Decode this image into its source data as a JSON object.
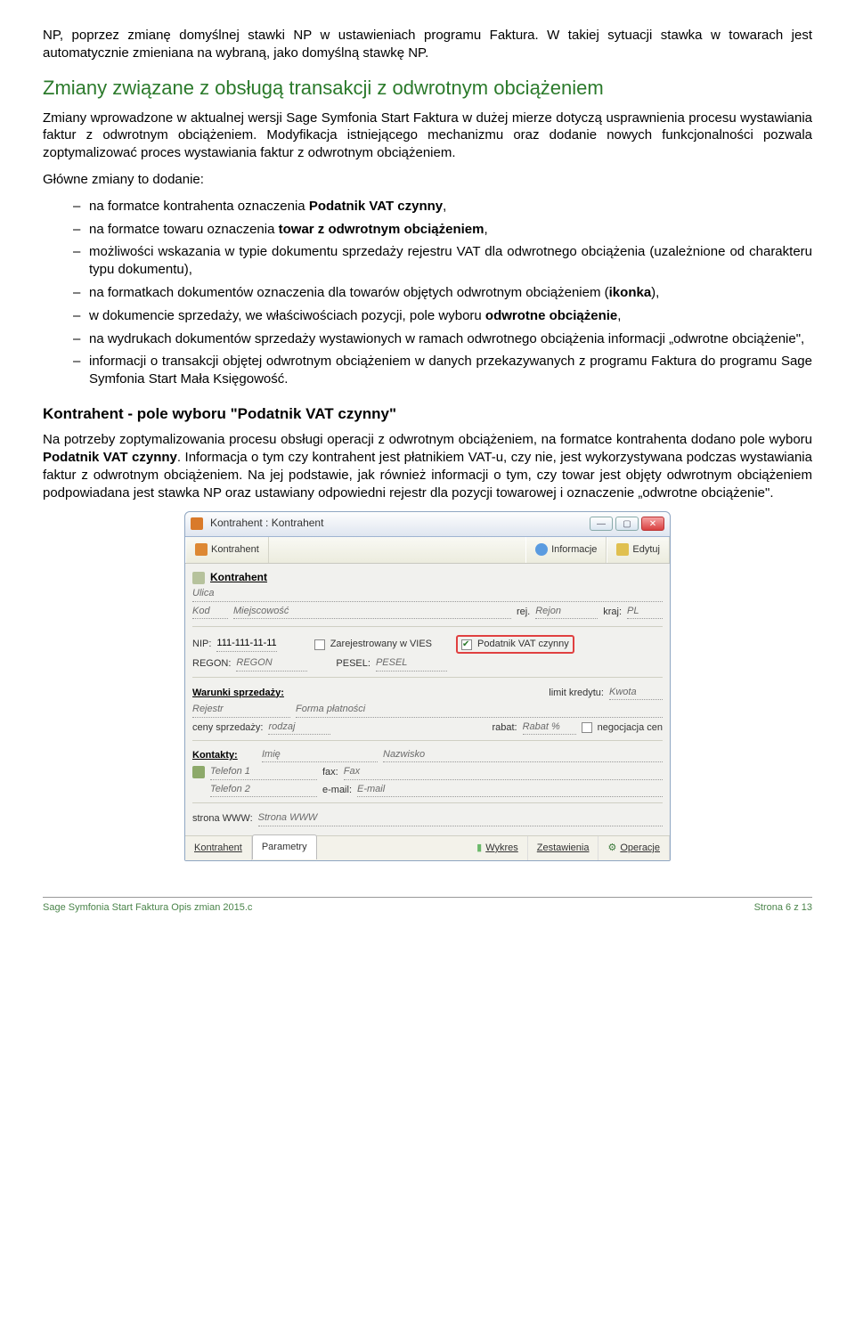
{
  "doc": {
    "p_intro": "NP, poprzez zmianę domyślnej stawki NP w ustawieniach programu Faktura. W takiej sytuacji stawka w towarach jest automatycznie zmieniana na wybraną, jako domyślną stawkę NP.",
    "h2_changes": "Zmiany związane z obsługą transakcji z odwrotnym obciążeniem",
    "p_changes1": "Zmiany wprowadzone w aktualnej wersji Sage Symfonia Start Faktura w dużej mierze dotyczą usprawnienia procesu wystawiania faktur z odwrotnym obciążeniem. Modyfikacja istniejącego mechanizmu oraz dodanie nowych funkcjonalności pozwala zoptymalizować proces wystawiania faktur z odwrotnym obciążeniem.",
    "p_changes2": "Główne zmiany to dodanie:",
    "bullets": [
      {
        "pre": "na formatce kontrahenta oznaczenia ",
        "b": "Podatnik VAT czynny",
        "post": ","
      },
      {
        "pre": "na formatce towaru oznaczenia ",
        "b": "towar z odwrotnym obciążeniem",
        "post": ","
      },
      {
        "pre": "możliwości wskazania w typie dokumentu sprzedaży rejestru VAT dla odwrotnego obciążenia (uzależnione od charakteru typu dokumentu),",
        "b": "",
        "post": ""
      },
      {
        "pre": "na formatkach dokumentów oznaczenia dla towarów objętych odwrotnym obciążeniem (",
        "b": "ikonka",
        "post": "),"
      },
      {
        "pre": "w dokumencie sprzedaży, we właściwościach pozycji, pole wyboru ",
        "b": "odwrotne obciążenie",
        "post": ","
      },
      {
        "pre": "na wydrukach dokumentów sprzedaży wystawionych w ramach odwrotnego obciążenia informacji „odwrotne obciążenie\",",
        "b": "",
        "post": ""
      },
      {
        "pre": "informacji o transakcji objętej odwrotnym obciążeniem w danych przekazywanych z programu Faktura do programu Sage Symfonia Start Mała Księgowość.",
        "b": "",
        "post": ""
      }
    ],
    "h3_kontr": "Kontrahent - pole wyboru \"Podatnik VAT czynny\"",
    "p_kontr_pre": "Na potrzeby zoptymalizowania procesu obsługi operacji z odwrotnym obciążeniem, na formatce kontrahenta dodano pole wyboru ",
    "p_kontr_b": "Podatnik VAT czynny",
    "p_kontr_post": ". Informacja o tym czy kontrahent jest płatnikiem VAT-u, czy nie, jest wykorzystywana podczas wystawiania faktur z odwrotnym obciążeniem. Na jej podstawie, jak również informacji o tym, czy towar jest objęty odwrotnym obciążeniem podpowiadana jest stawka NP oraz ustawiany odpowiedni rejestr dla pozycji towarowej i oznaczenie „odwrotne obciążenie\"."
  },
  "win": {
    "title": "Kontrahent : Kontrahent",
    "toolbar": {
      "left": "Kontrahent",
      "info": "Informacje",
      "edit": "Edytuj"
    },
    "name": "Kontrahent",
    "ulica_lbl": "Ulica",
    "ulica_val": "",
    "kod_lbl": "Kod",
    "kod_val": "",
    "miejsc_lbl": "Miejscowość",
    "miejsc_val": "",
    "rej_lbl": "rej.",
    "rej_val": "Rejon",
    "kraj_lbl": "kraj:",
    "kraj_val": "PL",
    "nip_lbl": "NIP:",
    "nip_val": "111-111-11-11",
    "vies": "Zarejestrowany w VIES",
    "vatczynny": "Podatnik VAT czynny",
    "regon_lbl": "REGON:",
    "regon_val": "REGON",
    "pesel_lbl": "PESEL:",
    "pesel_val": "PESEL",
    "ws_heading": "Warunki sprzedaży:",
    "limit_lbl": "limit kredytu:",
    "limit_val": "Kwota",
    "rejestr_lbl": "Rejestr",
    "rejestr_val": "",
    "forma_lbl": "Forma płatności",
    "forma_val": "",
    "ceny_lbl": "ceny sprzedaży:",
    "ceny_val": "rodzaj",
    "rabat_lbl": "rabat:",
    "rabat_val": "Rabat %",
    "negocjacja": "negocjacja cen",
    "kontakty_heading": "Kontakty:",
    "imie_lbl": "Imię",
    "imie_val": "",
    "nazw_lbl": "Nazwisko",
    "nazw_val": "",
    "tel1_lbl": "Telefon 1",
    "tel1_val": "",
    "fax_lbl": "fax:",
    "fax_val": "Fax",
    "tel2_lbl": "Telefon 2",
    "tel2_val": "",
    "email_lbl": "e-mail:",
    "email_val": "E-mail",
    "www_lbl": "strona WWW:",
    "www_val": "Strona WWW",
    "tabs": {
      "kontr": "Kontrahent",
      "param": "Parametry",
      "wykres": "Wykres",
      "zest": "Zestawienia",
      "oper": "Operacje"
    }
  },
  "footer": {
    "left": "Sage Symfonia Start Faktura Opis zmian 2015.c",
    "right": "Strona 6 z 13"
  }
}
